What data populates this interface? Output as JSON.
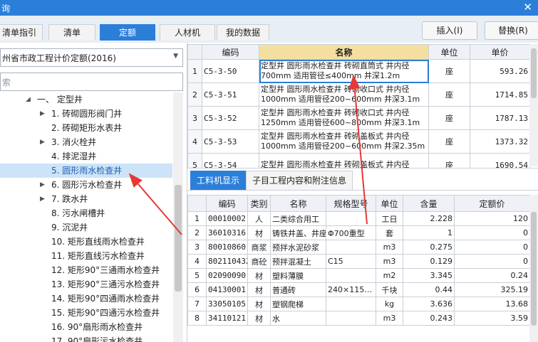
{
  "window": {
    "title": "询",
    "close_glyph": "✕"
  },
  "tabs": [
    {
      "label": "清单指引",
      "active": false
    },
    {
      "label": "清单",
      "active": false
    },
    {
      "label": "定额",
      "active": true
    },
    {
      "label": "人材机",
      "active": false
    },
    {
      "label": "我的数据",
      "active": false
    }
  ],
  "buttons": {
    "insert": "插入(I)",
    "replace": "替换(R)"
  },
  "left": {
    "library": "州省市政工程计价定额(2016)",
    "search_placeholder": "索",
    "tree": [
      {
        "label": "一、 定型井",
        "expander": "collapse",
        "level": 0
      },
      {
        "label": "1. 砖砌圆形阀门井",
        "expander": "expand",
        "level": 1
      },
      {
        "label": "2. 砖砌矩形水表井",
        "expander": "",
        "level": 1
      },
      {
        "label": "3. 消火栓井",
        "expander": "expand",
        "level": 1
      },
      {
        "label": "4. 排泥湿井",
        "expander": "",
        "level": 1
      },
      {
        "label": "5. 圆形雨水检查井",
        "expander": "",
        "level": 1,
        "selected": true
      },
      {
        "label": "6. 圆形污水检查井",
        "expander": "expand",
        "level": 1
      },
      {
        "label": "7. 跌水井",
        "expander": "expand",
        "level": 1
      },
      {
        "label": "8. 污水闸槽井",
        "expander": "",
        "level": 1
      },
      {
        "label": "9. 沉泥井",
        "expander": "",
        "level": 1
      },
      {
        "label": "10. 矩形直线雨水检查井",
        "expander": "",
        "level": 1
      },
      {
        "label": "11. 矩形直线污水检查井",
        "expander": "",
        "level": 1
      },
      {
        "label": "12. 矩形90°三通雨水检查井",
        "expander": "",
        "level": 1
      },
      {
        "label": "13. 矩形90°三通污水检查井",
        "expander": "",
        "level": 1
      },
      {
        "label": "14. 矩形90°四通雨水检查井",
        "expander": "",
        "level": 1
      },
      {
        "label": "15. 矩形90°四通污水检查井",
        "expander": "",
        "level": 1
      },
      {
        "label": "16. 90°扇形雨水检查井",
        "expander": "",
        "level": 1
      },
      {
        "label": "17. 90°扇形污水检查井",
        "expander": "",
        "level": 1
      }
    ]
  },
  "quota_table": {
    "headers": [
      "编码",
      "名称",
      "单位",
      "单价"
    ],
    "rows": [
      {
        "idx": "1",
        "code": "C5-3-50",
        "name": "定型井 圆形雨水检查井 砖砌直筒式 井内径700mm 适用管径≤400mm 井深1.2m",
        "unit": "座",
        "price": "593.26"
      },
      {
        "idx": "2",
        "code": "C5-3-51",
        "name": "定型井 圆形雨水检查井 砖砌收口式 井内径1000mm 适用管径200~600mm 井深3.1m",
        "unit": "座",
        "price": "1714.85"
      },
      {
        "idx": "3",
        "code": "C5-3-52",
        "name": "定型井 圆形雨水检查井 砖砌收口式 井内径1250mm 适用管径600~800mm 井深3.1m",
        "unit": "座",
        "price": "1787.13"
      },
      {
        "idx": "4",
        "code": "C5-3-53",
        "name": "定型井 圆形雨水检查井 砖砌盖板式 井内径1000mm 适用管径200~600mm 井深2.35m",
        "unit": "座",
        "price": "1373.32"
      },
      {
        "idx": "5",
        "code": "C5-3-54",
        "name": "定型井 圆形雨水检查井 砖砌盖板式 井内径",
        "unit": "座",
        "price": "1690.54"
      }
    ]
  },
  "subtabs": [
    {
      "label": "工料机显示",
      "active": true
    },
    {
      "label": "子目工程内容和附注信息",
      "active": false
    }
  ],
  "material_table": {
    "headers": [
      "编码",
      "类别",
      "名称",
      "规格型号",
      "单位",
      "含量",
      "定额价"
    ],
    "rows": [
      {
        "idx": "1",
        "code": "00010002",
        "type": "人",
        "name": "二类综合用工",
        "spec": "",
        "unit": "工日",
        "qty": "2.228",
        "price": "120"
      },
      {
        "idx": "2",
        "code": "36010316",
        "type": "材",
        "name": "铸铁井盖、井座",
        "spec": "Φ700重型",
        "unit": "套",
        "qty": "1",
        "price": "0"
      },
      {
        "idx": "3",
        "code": "80010860",
        "type": "商浆",
        "name": "预拌水泥砂浆",
        "spec": "",
        "unit": "m3",
        "qty": "0.275",
        "price": "0"
      },
      {
        "idx": "4",
        "code": "80211043Z",
        "type": "商砼",
        "name": "预拌混凝土",
        "spec": "C15",
        "unit": "m3",
        "qty": "0.129",
        "price": "0"
      },
      {
        "idx": "5",
        "code": "02090090",
        "type": "材",
        "name": "塑料薄膜",
        "spec": "",
        "unit": "m2",
        "qty": "3.345",
        "price": "0.24"
      },
      {
        "idx": "6",
        "code": "04130001",
        "type": "材",
        "name": "普通砖",
        "spec": "240×115…",
        "unit": "千块",
        "qty": "0.44",
        "price": "325.19"
      },
      {
        "idx": "7",
        "code": "33050105",
        "type": "材",
        "name": "塑钢爬梯",
        "spec": "",
        "unit": "kg",
        "qty": "3.636",
        "price": "13.68"
      },
      {
        "idx": "8",
        "code": "34110121",
        "type": "材",
        "name": "水",
        "spec": "",
        "unit": "m3",
        "qty": "0.243",
        "price": "3.59"
      }
    ]
  },
  "colors": {
    "accent": "#2b7fd9",
    "arrow": "#e53935",
    "highlight_header": "#f5dfa0"
  }
}
